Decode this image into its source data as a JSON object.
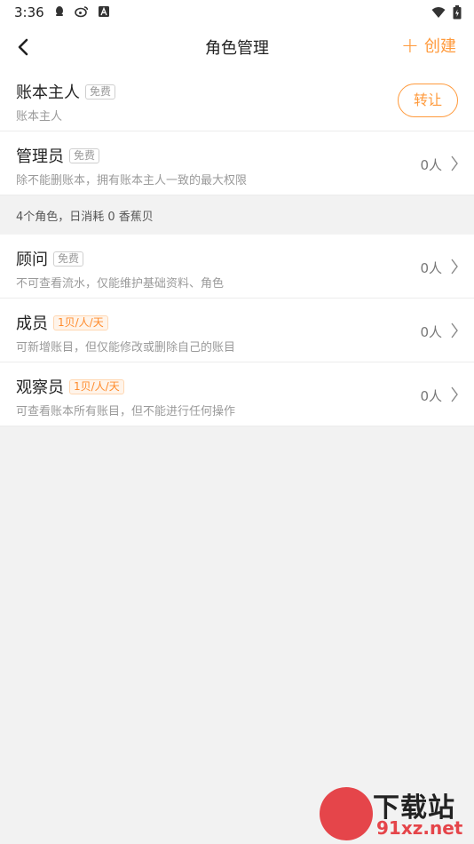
{
  "status_bar": {
    "time": "3:36",
    "left_icons": [
      "qq-icon",
      "weibo-icon",
      "a-icon"
    ],
    "right_icons": [
      "wifi-icon",
      "battery-icon"
    ]
  },
  "header": {
    "title": "角色管理",
    "create_label": "创建",
    "create_icon": "plus-icon"
  },
  "roles_primary": [
    {
      "name": "账本主人",
      "tag": "免费",
      "desc": "账本主人",
      "action": "转让"
    },
    {
      "name": "管理员",
      "tag": "免费",
      "desc": "除不能删账本，拥有账本主人一致的最大权限",
      "count": "0人"
    }
  ],
  "section_note": "4个角色，日消耗 0 香蕉贝",
  "roles_secondary": [
    {
      "name": "顾问",
      "tag": "免费",
      "desc": "不可查看流水，仅能维护基础资料、角色",
      "count": "0人"
    },
    {
      "name": "成员",
      "tag": "1贝/人/天",
      "desc": "可新增账目，但仅能修改或删除自己的账目",
      "count": "0人"
    },
    {
      "name": "观察员",
      "tag": "1贝/人/天",
      "desc": "可查看账本所有账目，但不能进行任何操作",
      "count": "0人"
    }
  ],
  "watermark": {
    "top": "下载站",
    "bottom": "91xz.net"
  },
  "colors": {
    "accent": "#ff9a3c",
    "tag_paid": "#ff8a2a",
    "background": "#f2f2f2"
  }
}
